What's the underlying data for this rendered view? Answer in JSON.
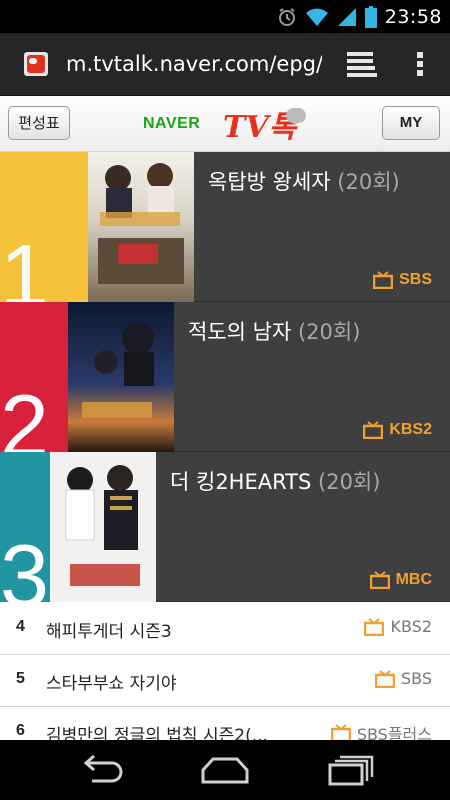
{
  "status_bar": {
    "time": "23:58"
  },
  "browser": {
    "url": "m.tvtalk.naver.com/epg/t"
  },
  "header": {
    "schedule_label": "편성표",
    "logo_naver": "NAVER",
    "logo_tv": "TV톡",
    "my_label": "MY"
  },
  "rankings": [
    {
      "rank": "1",
      "title": "옥탑방 왕세자",
      "episode": "(20회)",
      "channel": "SBS"
    },
    {
      "rank": "2",
      "title": "적도의 남자",
      "episode": "(20회)",
      "channel": "KBS2"
    },
    {
      "rank": "3",
      "title": "더 킹2HEARTS",
      "episode": "(20회)",
      "channel": "MBC"
    }
  ],
  "list": [
    {
      "rank": "4",
      "title": "해피투게더 시즌3",
      "channel": "KBS2"
    },
    {
      "rank": "5",
      "title": "스타부부쇼 자기야",
      "channel": "SBS"
    },
    {
      "rank": "6",
      "title": "김병만의 정글의 법칙 시즌2(...",
      "channel": "SBS플러스"
    }
  ],
  "colors": {
    "rank1": "#f5c33b",
    "rank2": "#d8213a",
    "rank3": "#2196a0",
    "channel_accent": "#f0a030"
  },
  "icons": {
    "status": [
      "alarm-icon",
      "wifi-icon",
      "signal-icon",
      "battery-icon"
    ],
    "browser": [
      "tabs-icon",
      "overflow-menu-icon"
    ],
    "channel": "tv-icon",
    "nav": [
      "back-icon",
      "home-icon",
      "recent-apps-icon"
    ]
  }
}
